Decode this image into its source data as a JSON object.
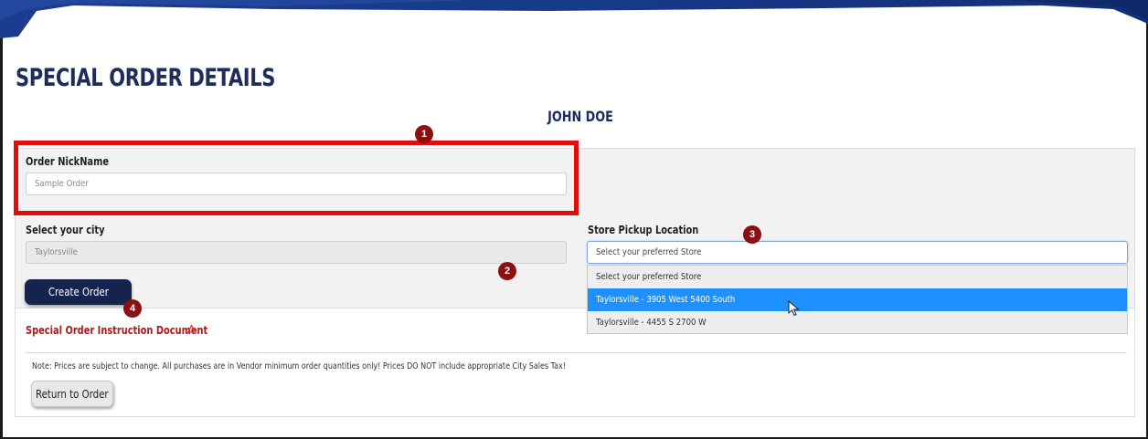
{
  "page": {
    "title": "SPECIAL ORDER DETAILS",
    "customer_name": "JOHN DOE"
  },
  "form": {
    "nickname": {
      "label": "Order NickName",
      "placeholder": "Sample Order"
    },
    "city": {
      "label": "Select your city",
      "value": "Taylorsville"
    },
    "store": {
      "label": "Store Pickup Location",
      "selected_text": "Select your preferred Store",
      "options": [
        "Select your preferred Store",
        "Taylorsville - 3905 West 5400 South",
        "Taylorsville - 4455 S 2700 W"
      ],
      "highlighted_option": "Taylorsville - 3905 West 5400 South"
    },
    "create_button": "Create Order"
  },
  "annotations": {
    "markers": [
      "1",
      "2",
      "3",
      "4"
    ],
    "highlight_color": "#e20c0c",
    "marker_color": "#8c1010"
  },
  "instruction_link": "Special Order Instruction Document",
  "note": "Note: Prices are subject to change. All purchases are in Vendor minimum order quantities only! Prices DO NOT include appropriate City Sales Tax!",
  "return_button": "Return to Order",
  "colors": {
    "brand_navy": "#14244f",
    "title_navy": "#1d2d5b",
    "link_red": "#b01a1a",
    "selection_blue": "#1e90ff"
  },
  "icons": {
    "pdf": "pdf-icon",
    "cursor": "mouse-pointer-icon"
  }
}
